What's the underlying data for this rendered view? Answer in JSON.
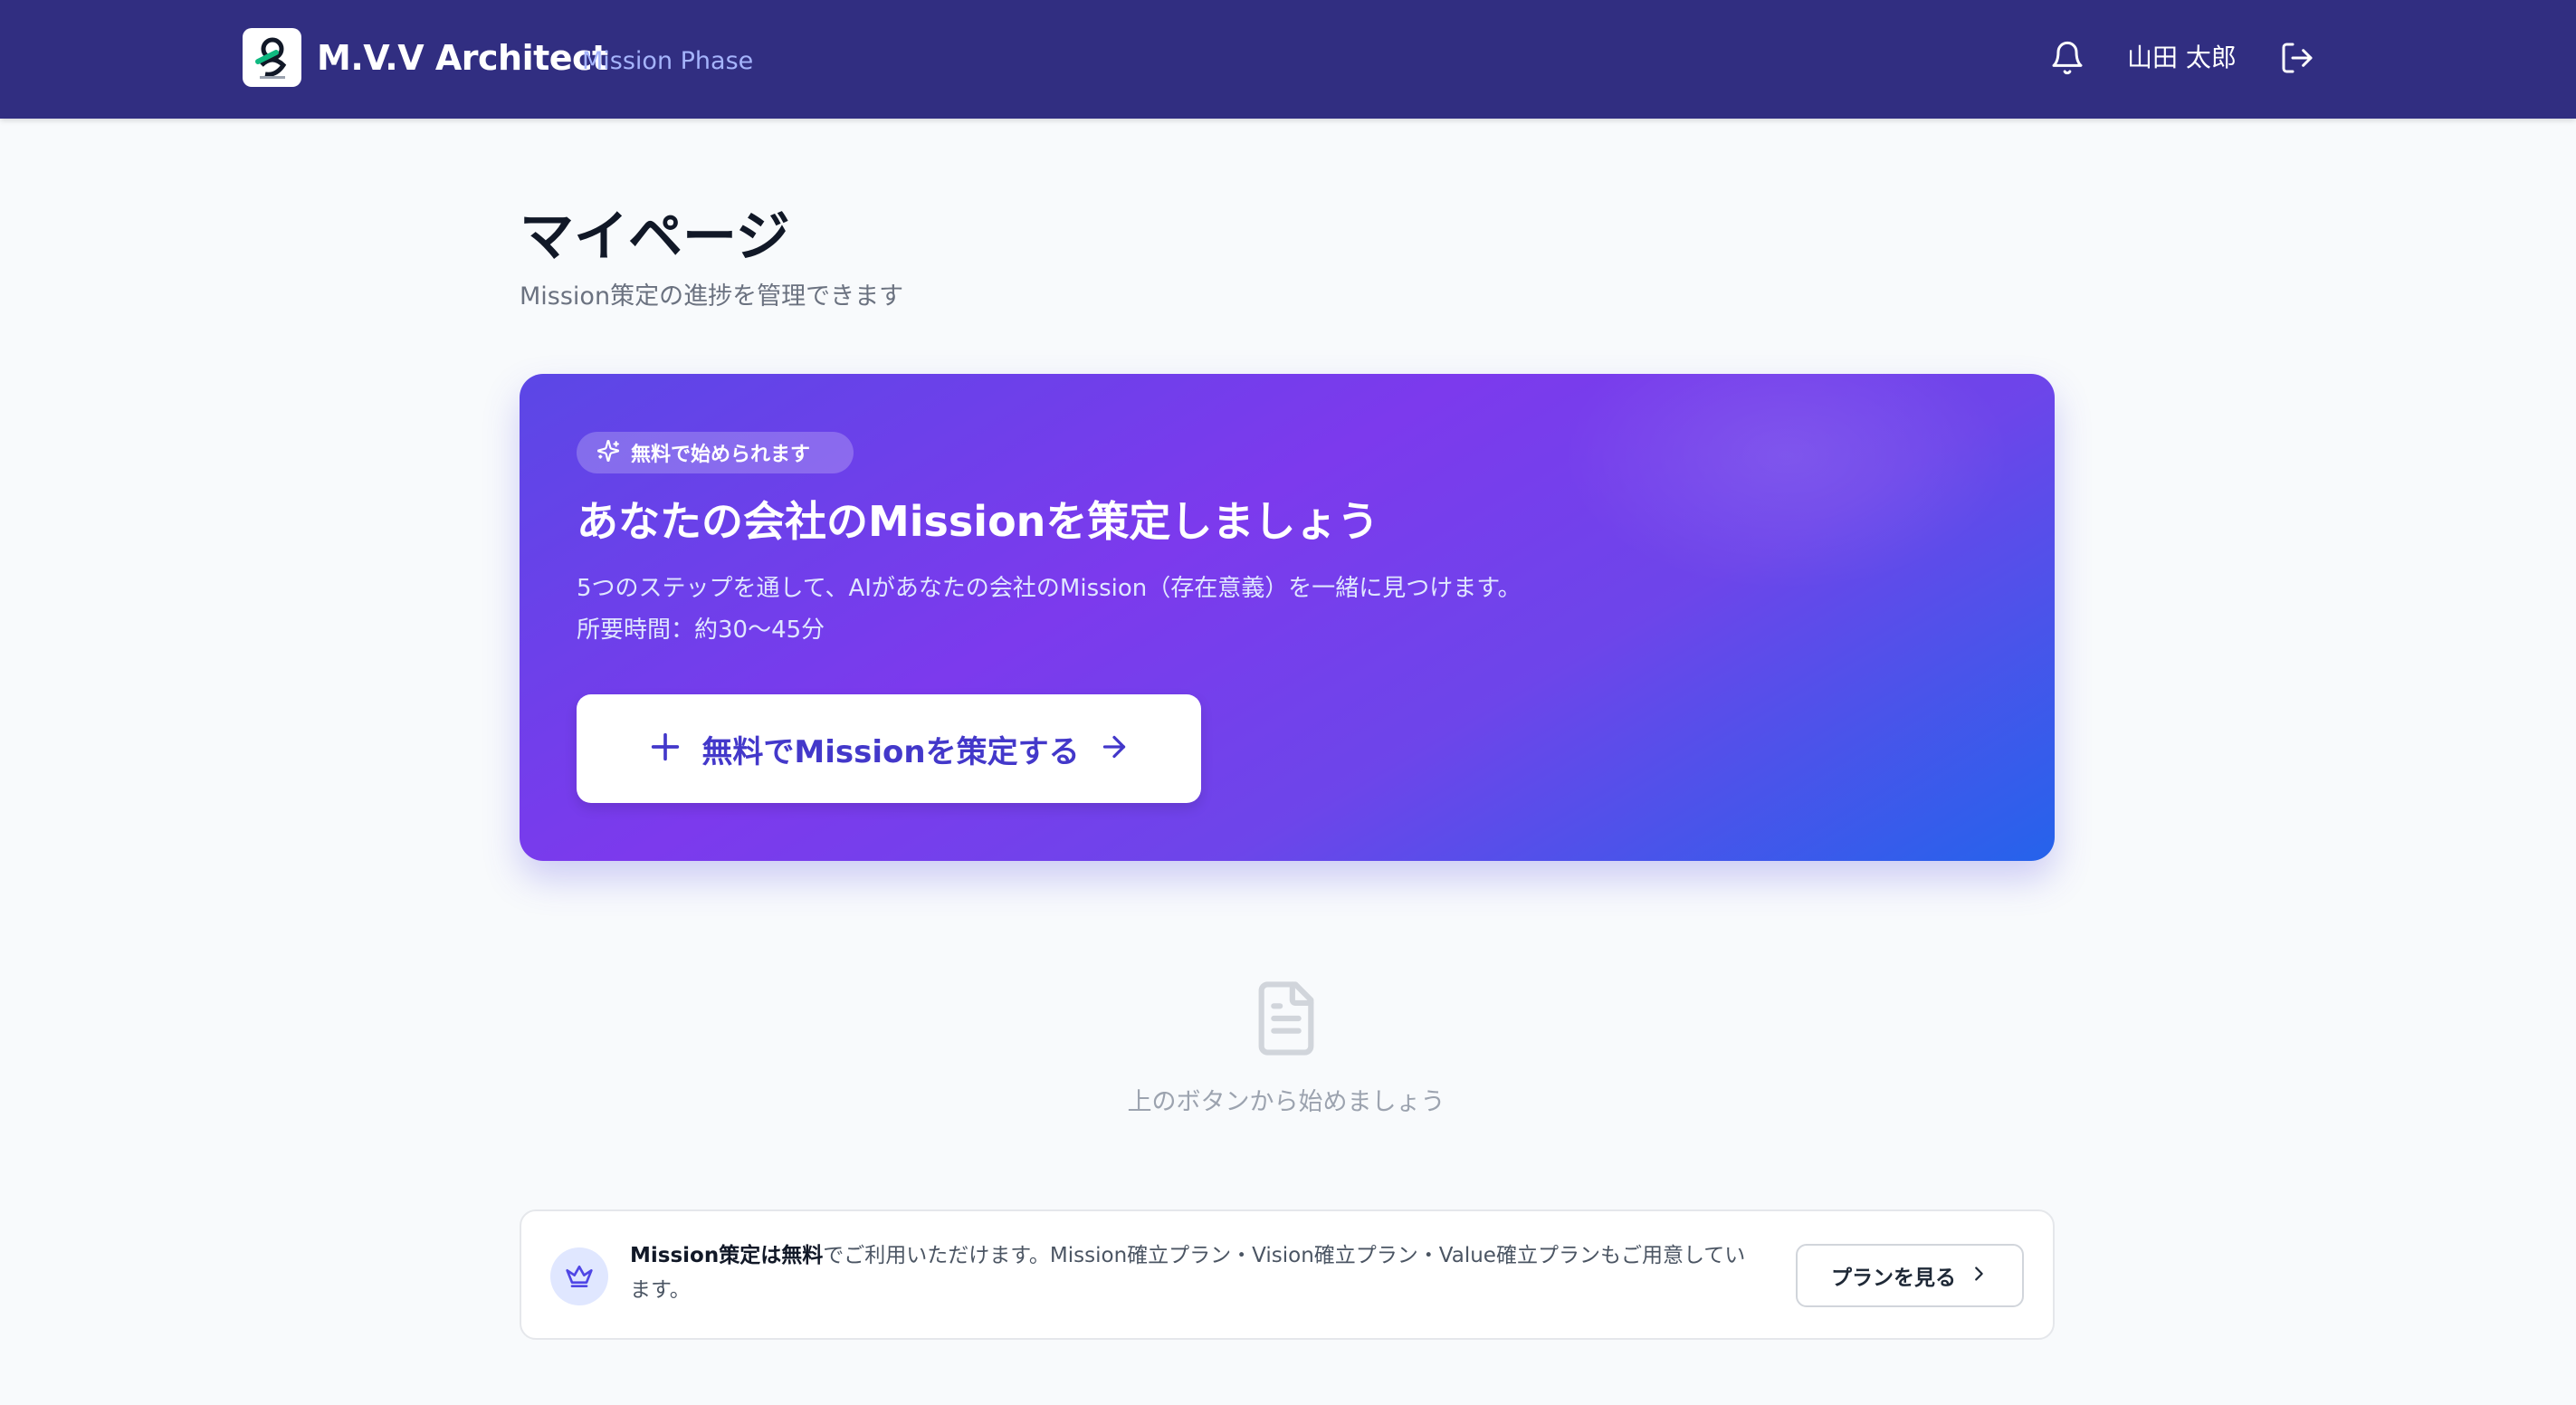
{
  "header": {
    "app_title": "M.V.V Architect",
    "phase": "Mission Phase",
    "user_name": "山田 太郎",
    "bg_color": "#312e81",
    "icons": [
      "logo-icon",
      "bell-icon",
      "logout-icon"
    ]
  },
  "page": {
    "title": "マイページ",
    "subtitle": "Mission策定の進捗を管理できます"
  },
  "hero": {
    "badge": "無料で始められます",
    "title": "あなたの会社のMissionを策定しましょう",
    "description_line1": "5つのステップを通して、AIがあなたの会社のMission（存在意義）を一緒に見つけます。",
    "description_line2": "所要時間：約30〜45分",
    "cta_label": "無料でMissionを策定する",
    "gradient_colors": [
      "#5b47e6",
      "#7c3aed",
      "#2563eb"
    ],
    "icons": [
      "sparkles-icon",
      "plus-icon",
      "arrow-right-icon"
    ]
  },
  "empty_state": {
    "text": "上のボタンから始めましょう",
    "icon": "document-icon"
  },
  "info_box": {
    "bold_text": "Mission策定は無料",
    "text": "でご利用いただけます。Mission確立プラン・Vision確立プラン・Value確立プランもご用意しています。",
    "button_label": "プランを見る",
    "icons": [
      "crown-icon",
      "chevron-right-icon"
    ]
  }
}
